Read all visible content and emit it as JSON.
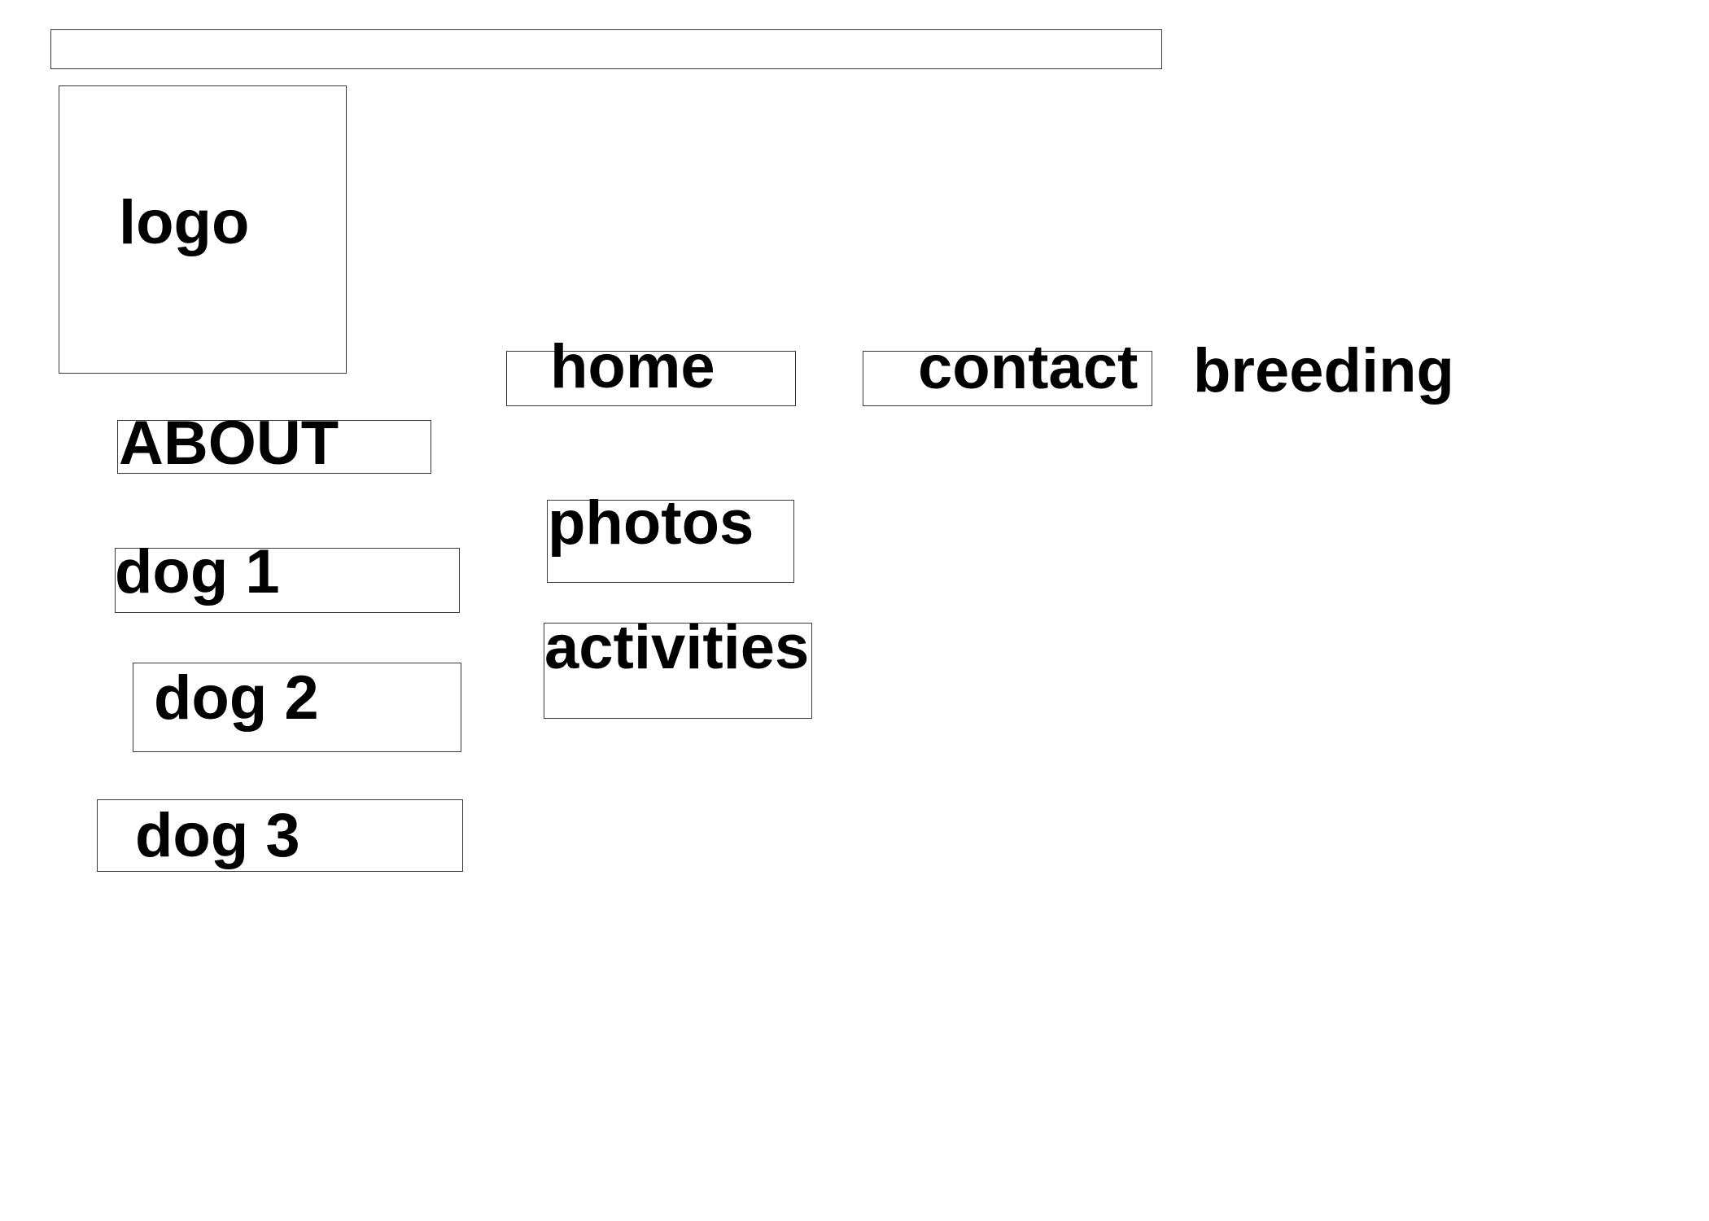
{
  "logo": {
    "label": "logo"
  },
  "nav": {
    "home": "home",
    "contact": "contact",
    "breeding": "breeding"
  },
  "sidebar": {
    "about": "ABOUT",
    "dogs": [
      "dog 1",
      "dog 2",
      "dog 3"
    ]
  },
  "links": {
    "photos": "photos",
    "activities": "activities"
  }
}
